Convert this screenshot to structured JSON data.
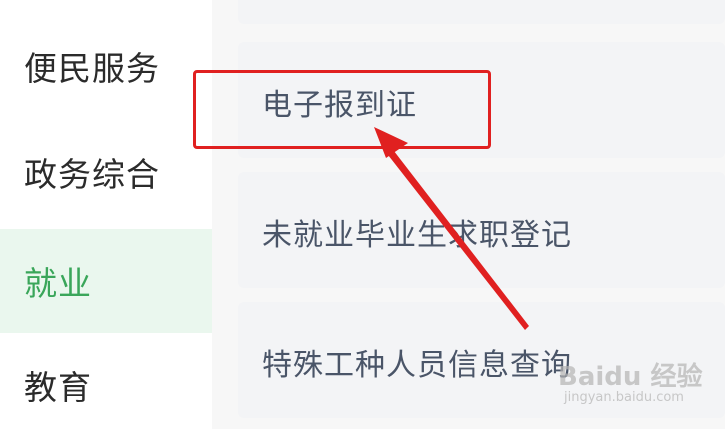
{
  "sidebar": {
    "items": [
      {
        "label": "便民服务",
        "active": false
      },
      {
        "label": "政务综合",
        "active": false
      },
      {
        "label": "就业",
        "active": true
      },
      {
        "label": "教育",
        "active": false
      }
    ],
    "active_color": "#3aa65a"
  },
  "services": [
    {
      "label": "电子报到证",
      "highlighted": true
    },
    {
      "label": "未就业毕业生求职登记"
    },
    {
      "label": "特殊工种人员信息查询"
    }
  ],
  "annotation": {
    "box_color": "#e02020",
    "arrow_color": "#e02020"
  },
  "watermark": {
    "main": "Baidu 经验",
    "sub": "jingyan.baidu.com"
  }
}
